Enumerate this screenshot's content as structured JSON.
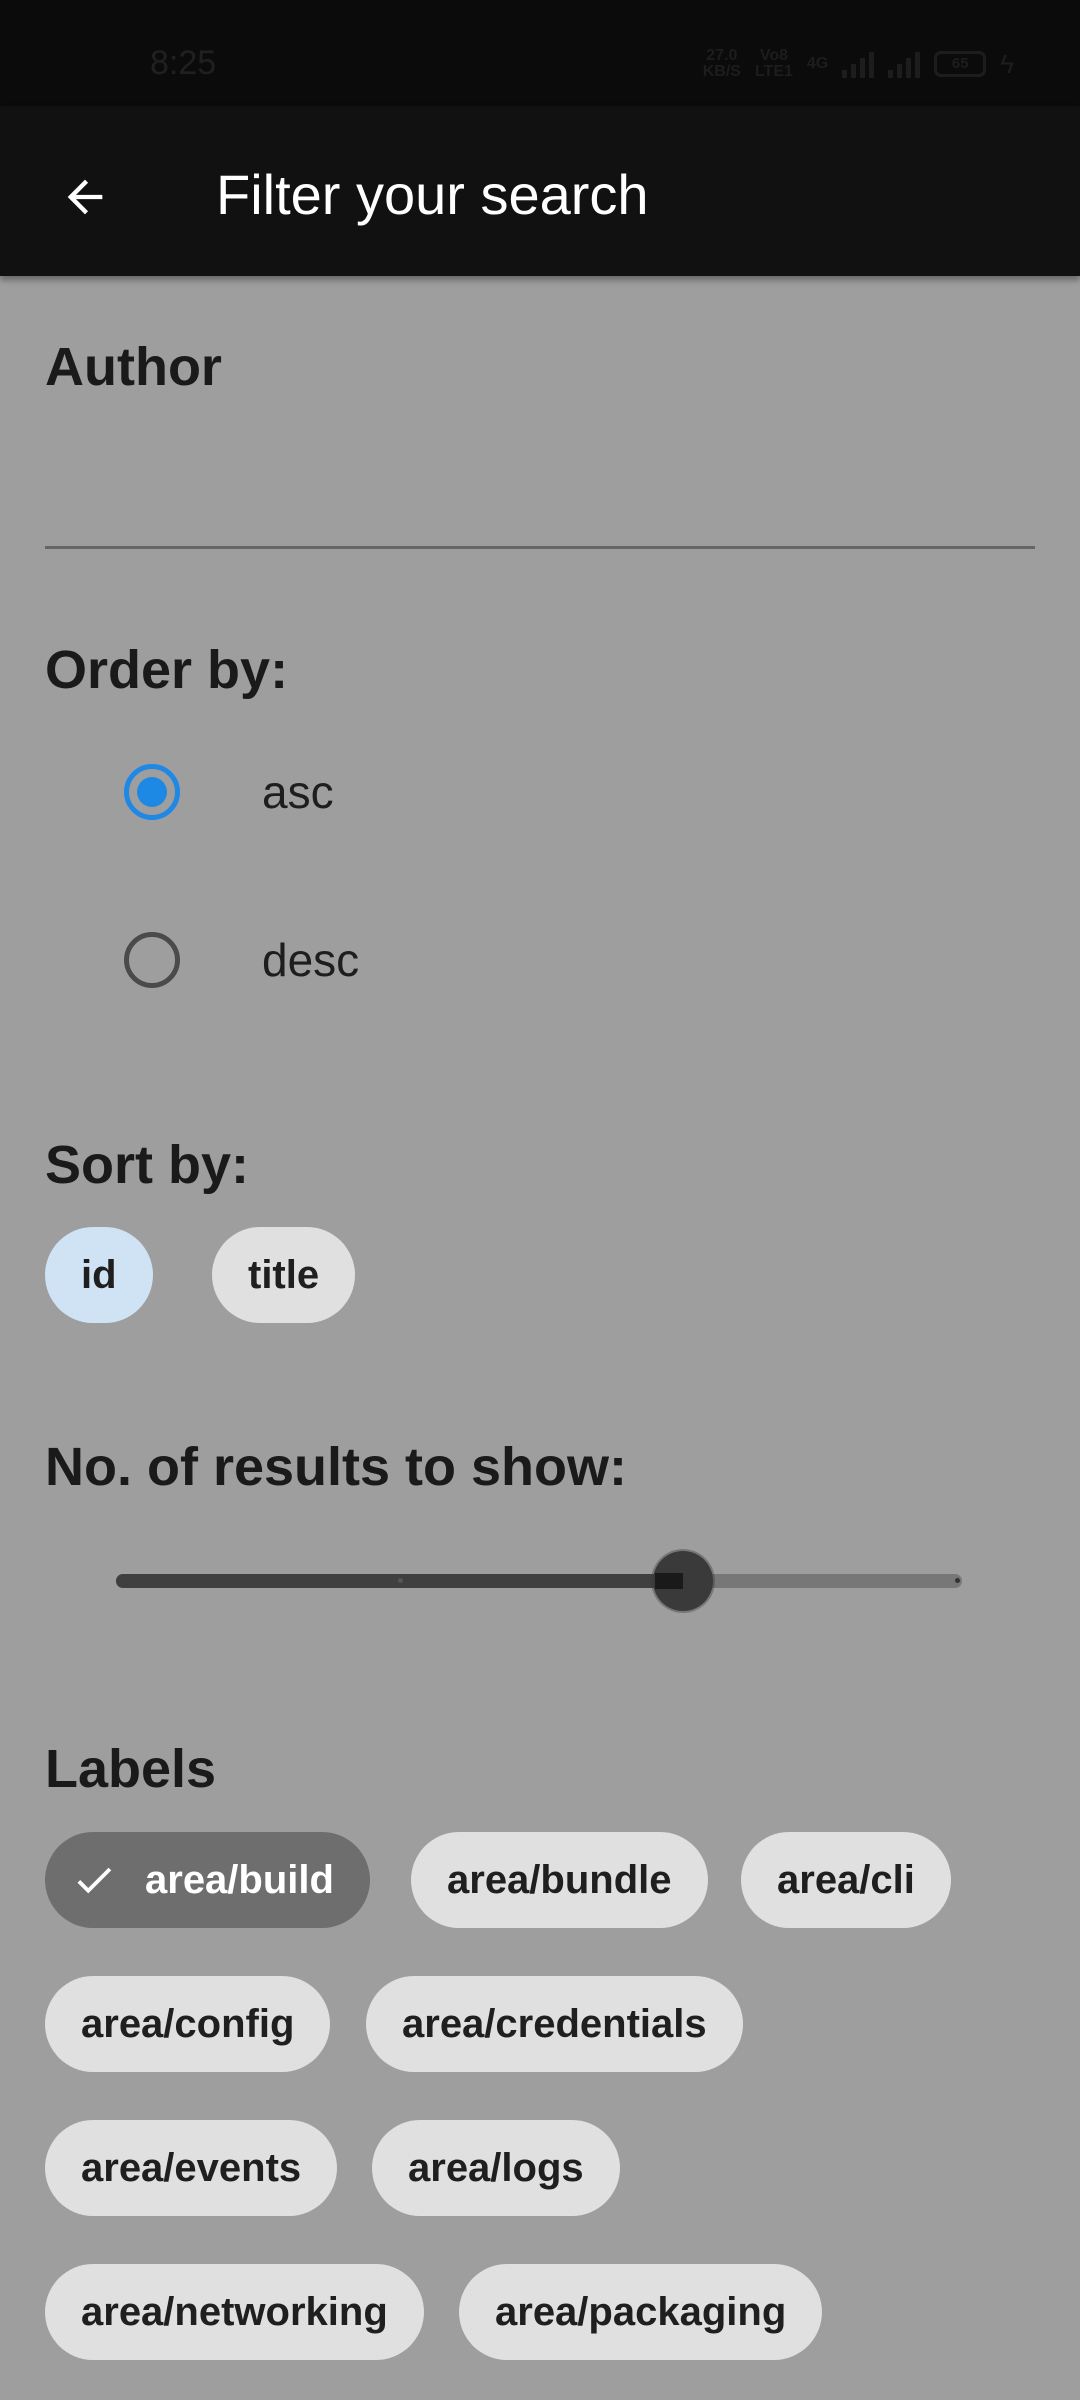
{
  "status_bar": {
    "time": "8:25",
    "speed_value": "27.0",
    "speed_unit": "KB/S",
    "volte1": "Vo8",
    "volte2": "LTE1",
    "network": "4G",
    "battery": "65"
  },
  "app_bar": {
    "back_icon": "arrow-left-icon",
    "title": "Filter your search"
  },
  "author": {
    "label": "Author",
    "value": "",
    "placeholder": ""
  },
  "order_by": {
    "label": "Order by:",
    "options": [
      {
        "label": "asc",
        "checked": true
      },
      {
        "label": "desc",
        "checked": false
      }
    ]
  },
  "sort_by": {
    "label": "Sort by:",
    "chips": [
      {
        "label": "id",
        "selected": true
      },
      {
        "label": "title",
        "selected": false
      }
    ]
  },
  "results": {
    "label": "No. of results to show:",
    "slider_fraction": 0.67
  },
  "labels": {
    "label": "Labels",
    "chips": [
      {
        "label": "area/build",
        "selected": true
      },
      {
        "label": "area/bundle",
        "selected": false
      },
      {
        "label": "area/cli",
        "selected": false
      },
      {
        "label": "area/config",
        "selected": false
      },
      {
        "label": "area/credentials",
        "selected": false
      },
      {
        "label": "area/events",
        "selected": false
      },
      {
        "label": "area/logs",
        "selected": false
      },
      {
        "label": "area/networking",
        "selected": false
      },
      {
        "label": "area/packaging",
        "selected": false
      }
    ]
  },
  "colors": {
    "accent": "#1e88e5",
    "scrim_background": "#9e9e9e",
    "app_bar": "#111111",
    "chip": "#e0e0e0",
    "chip_selected_blue": "#cfe3f5",
    "chip_selected_dark": "#6e6e6e"
  }
}
